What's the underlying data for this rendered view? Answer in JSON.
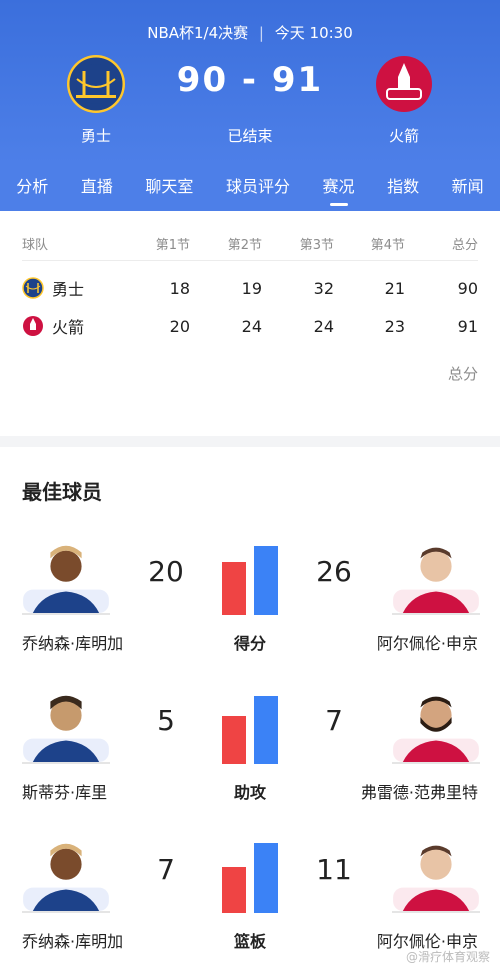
{
  "match": {
    "event": "NBA杯1/4决赛",
    "time": "今天 10:30",
    "score": "90 - 91",
    "status": "已结束",
    "home": {
      "name": "勇士"
    },
    "away": {
      "name": "火箭"
    }
  },
  "tabs": [
    "分析",
    "直播",
    "聊天室",
    "球员评分",
    "赛况",
    "指数",
    "新闻"
  ],
  "active_tab_index": 4,
  "boxscore": {
    "headers": [
      "球队",
      "第1节",
      "第2节",
      "第3节",
      "第4节",
      "总分"
    ],
    "rows": [
      {
        "team": "勇士",
        "q": [
          "18",
          "19",
          "32",
          "21"
        ],
        "total": "90"
      },
      {
        "team": "火箭",
        "q": [
          "20",
          "24",
          "24",
          "23"
        ],
        "total": "91"
      }
    ],
    "total_link": "总分"
  },
  "best_players": {
    "title": "最佳球员",
    "stats": [
      {
        "label": "得分",
        "left_name": "乔纳森·库明加",
        "left_value": "20",
        "right_name": "阿尔佩伦·申京",
        "right_value": "26",
        "left_level": 0.66,
        "right_level": 0.86
      },
      {
        "label": "助攻",
        "left_name": "斯蒂芬·库里",
        "left_value": "5",
        "right_name": "弗雷德·范弗里特",
        "right_value": "7",
        "left_level": 0.6,
        "right_level": 0.85
      },
      {
        "label": "篮板",
        "left_name": "乔纳森·库明加",
        "left_value": "7",
        "right_name": "阿尔佩伦·申京",
        "right_value": "11",
        "left_level": 0.58,
        "right_level": 0.88
      }
    ]
  },
  "watermark": "@滑疗体育观察",
  "colors": {
    "header_bg": "#4d7fe8",
    "home_bar": "#ef4444",
    "away_bar": "#3b82f6",
    "warriors_blue": "#1d428a",
    "warriors_gold": "#ffc72c",
    "rockets_red": "#ce1141"
  }
}
